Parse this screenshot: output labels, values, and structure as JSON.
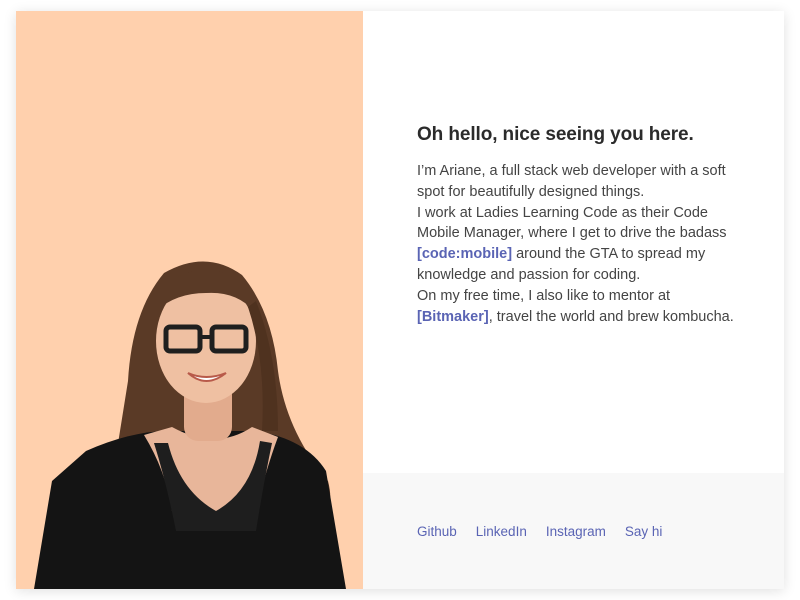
{
  "profile": {
    "photo_alt": "Portrait of Ariane",
    "panel_color": "#ffd0ad"
  },
  "intro": {
    "headline": "Oh hello, nice seeing you here.",
    "line1": "I’m Ariane, a full stack web developer with a soft spot for beautifully designed things.",
    "line2_before": "I work at Ladies Learning Code as their Code Mobile Manager, where I get to drive the badass ",
    "line2_link": "[code:mobile]",
    "line2_after": " around the GTA to spread my knowledge and passion for coding.",
    "line3_before": "On my free time, I also like to mentor at ",
    "line3_link": "[Bitmaker]",
    "line3_after": ", travel the world and brew kombucha."
  },
  "footer": {
    "links": [
      {
        "label": "Github"
      },
      {
        "label": "LinkedIn"
      },
      {
        "label": "Instagram"
      },
      {
        "label": "Say hi"
      }
    ]
  },
  "colors": {
    "accent": "#5a64b4",
    "text": "#444444",
    "heading": "#2b2b2b",
    "footer_bg": "#f8f8f8"
  }
}
